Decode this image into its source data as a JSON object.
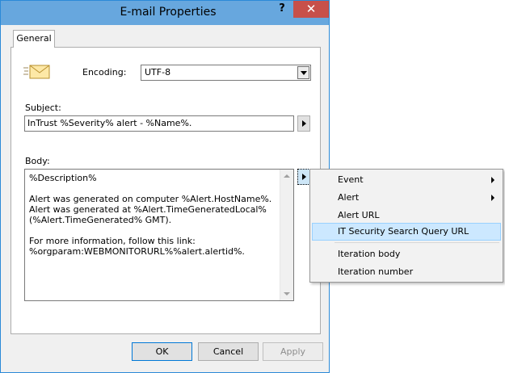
{
  "window": {
    "title": "E-mail Properties",
    "help_glyph": "?",
    "close_glyph": "✕"
  },
  "tabs": [
    {
      "label": "General"
    }
  ],
  "encoding": {
    "label": "Encoding:",
    "value": "UTF-8"
  },
  "subject": {
    "label": "Subject:",
    "value": "InTrust %Severity% alert - %Name%."
  },
  "body": {
    "label": "Body:",
    "value": "%Description%\n\nAlert was generated on computer %Alert.HostName%.\nAlert was generated at %Alert.TimeGeneratedLocal%\n(%Alert.TimeGenerated% GMT).\n\nFor more information, follow this link:\n%orgparam:WEBMONITORURL%%alert.alertid%."
  },
  "buttons": {
    "ok": "OK",
    "cancel": "Cancel",
    "apply": "Apply"
  },
  "context_menu": {
    "items": [
      {
        "label": "Event",
        "submenu": true
      },
      {
        "label": "Alert",
        "submenu": true
      },
      {
        "label": "Alert URL",
        "submenu": false
      },
      {
        "label": "IT Security Search Query URL",
        "submenu": false,
        "highlighted": true
      },
      {
        "label": "Iteration body",
        "submenu": false
      },
      {
        "label": "Iteration number",
        "submenu": false
      }
    ]
  },
  "icons": {
    "mail": "envelope-icon",
    "help": "help-icon",
    "close": "close-icon"
  },
  "colors": {
    "titlebar": "#67a7de",
    "close_button": "#c7504a",
    "menu_highlight": "#cce8ff"
  }
}
